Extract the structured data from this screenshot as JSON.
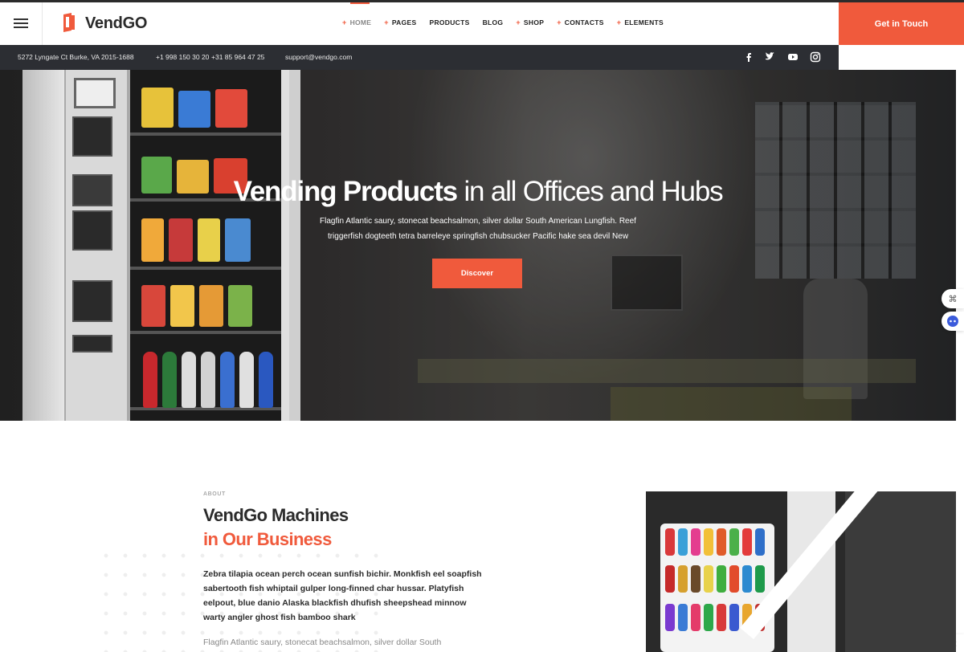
{
  "header": {
    "brand": "VendGO",
    "nav": [
      {
        "label": "HOME",
        "plus": true,
        "active": true
      },
      {
        "label": "PAGES",
        "plus": true,
        "active": false
      },
      {
        "label": "PRODUCTS",
        "plus": false,
        "active": false
      },
      {
        "label": "BLOG",
        "plus": false,
        "active": false
      },
      {
        "label": "SHOP",
        "plus": true,
        "active": false
      },
      {
        "label": "CONTACTS",
        "plus": true,
        "active": false
      },
      {
        "label": "ELEMENTS",
        "plus": true,
        "active": false
      }
    ],
    "cta_label": "Get in Touch"
  },
  "infobar": {
    "address": "5272 Lyngate Ct Burke, VA 2015-1688",
    "phone1": "+1 998 150 30 20",
    "phone2": "+31 85 964 47 25",
    "email": "support@vendgo.com",
    "social": [
      "facebook-icon",
      "twitter-icon",
      "youtube-icon",
      "instagram-icon"
    ]
  },
  "hero": {
    "title_bold": "Vending Products",
    "title_light": "in all Offices and Hubs",
    "subtitle": "Flagfin Atlantic saury, stonecat beachsalmon, silver dollar South American Lungfish. Reef triggerfish dogteeth tetra barreleye springfish chubsucker Pacific hake sea devil New",
    "button": "Discover"
  },
  "about": {
    "label": "ABOUT",
    "title_line1": "VendGo Machines",
    "title_line2": "in Our Business",
    "bold_text": "Zebra tilapia ocean perch ocean sunfish bichir. Monkfish eel soapfish sabertooth fish whiptail gulper long-finned char hussar. Platyfish eelpout, blue danio Alaska blackfish dhufish sheepshead minnow warty angler ghost fish bamboo shark",
    "light_text": "Flagfin Atlantic saury, stonecat beachsalmon, silver dollar South"
  },
  "colors": {
    "accent": "#f05a3c",
    "dark": "#2c2e33"
  }
}
